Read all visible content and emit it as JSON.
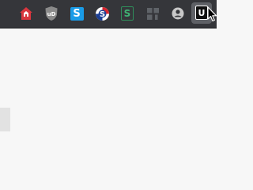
{
  "toolbar": {
    "extensions": [
      {
        "icon": "home-shield-icon"
      },
      {
        "icon": "ublock-origin-icon",
        "text": "uD"
      },
      {
        "icon": "s-badge-icon",
        "text": "S"
      },
      {
        "icon": "s-circle-icon",
        "text": "S"
      },
      {
        "icon": "s-green-icon",
        "text": "S"
      },
      {
        "icon": "extensions-puzzle-icon"
      },
      {
        "icon": "account-avatar-icon"
      },
      {
        "icon": "u-extension-icon",
        "text": "U"
      }
    ]
  },
  "colors": {
    "toolbar_bg": "#35363a",
    "content_bg": "#f7f7f7"
  }
}
